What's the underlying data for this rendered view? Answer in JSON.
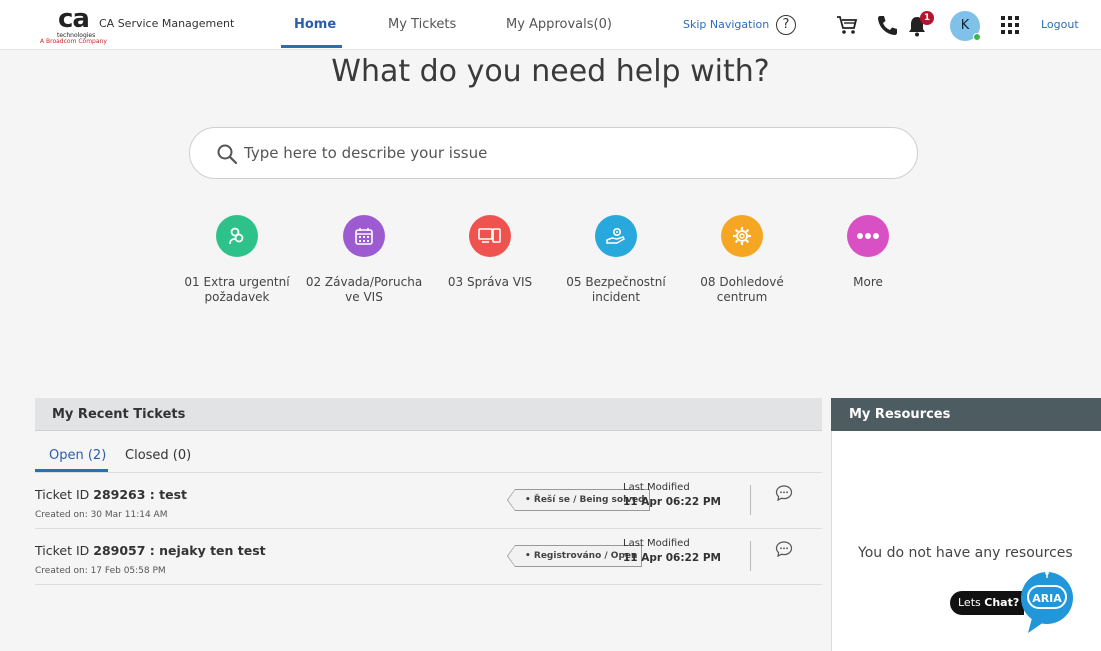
{
  "brand": {
    "logo_mark": "ca",
    "logo_sub": "technologies",
    "logo_tag": "A Broadcom Company",
    "app_name": "CA Service Management"
  },
  "nav": {
    "tabs": [
      {
        "label": "Home"
      },
      {
        "label": "My Tickets"
      },
      {
        "label": "My Approvals(0)"
      }
    ],
    "skip_navigation": "Skip Navigation",
    "help_glyph": "?",
    "notification_count": "1",
    "avatar_initial": "K",
    "logout": "Logout",
    "icons": [
      "help-icon",
      "cart-icon",
      "phone-icon",
      "bell-icon",
      "apps-grid-icon"
    ]
  },
  "hero": {
    "title": "What do you need help with?",
    "search_placeholder": "Type here to describe your issue"
  },
  "categories": [
    {
      "label": "01 Extra urgentní požadavek",
      "color": "#2ec28a",
      "icon": "people-icon"
    },
    {
      "label": "02 Závada/Porucha ve VIS",
      "color": "#9d5bd2",
      "icon": "calendar-icon"
    },
    {
      "label": "03 Správa VIS",
      "color": "#ef5350",
      "icon": "devices-icon"
    },
    {
      "label": "05 Bezpečnostní incident",
      "color": "#28a8dc",
      "icon": "hand-gear-icon"
    },
    {
      "label": "08 Dohledové centrum",
      "color": "#f5a623",
      "icon": "gear-icon"
    },
    {
      "label": "More",
      "color": "#d94fc4",
      "icon": "more-dots-icon"
    }
  ],
  "tickets": {
    "header": "My Recent Tickets",
    "tabs": [
      {
        "label": "Open (2)"
      },
      {
        "label": "Closed (0)"
      }
    ],
    "rows": [
      {
        "id_prefix": "Ticket ID",
        "id_value": "289263 : test",
        "created": "Created on: 30 Mar 11:14 AM",
        "status": "• Řeší se / Being solved",
        "last_modified_label": "Last Modified",
        "last_modified": "11 Apr 06:22 PM"
      },
      {
        "id_prefix": "Ticket ID",
        "id_value": "289057 : nejaky ten test",
        "created": "Created on: 17 Feb 05:58 PM",
        "status": "• Registrováno / Open",
        "last_modified_label": "Last Modified",
        "last_modified": "11 Apr 06:22 PM"
      }
    ]
  },
  "resources": {
    "header": "My Resources",
    "empty": "You do not have any resources"
  },
  "chat": {
    "prefix": "Lets",
    "bold": "Chat?",
    "bot_name": "ARIA"
  }
}
